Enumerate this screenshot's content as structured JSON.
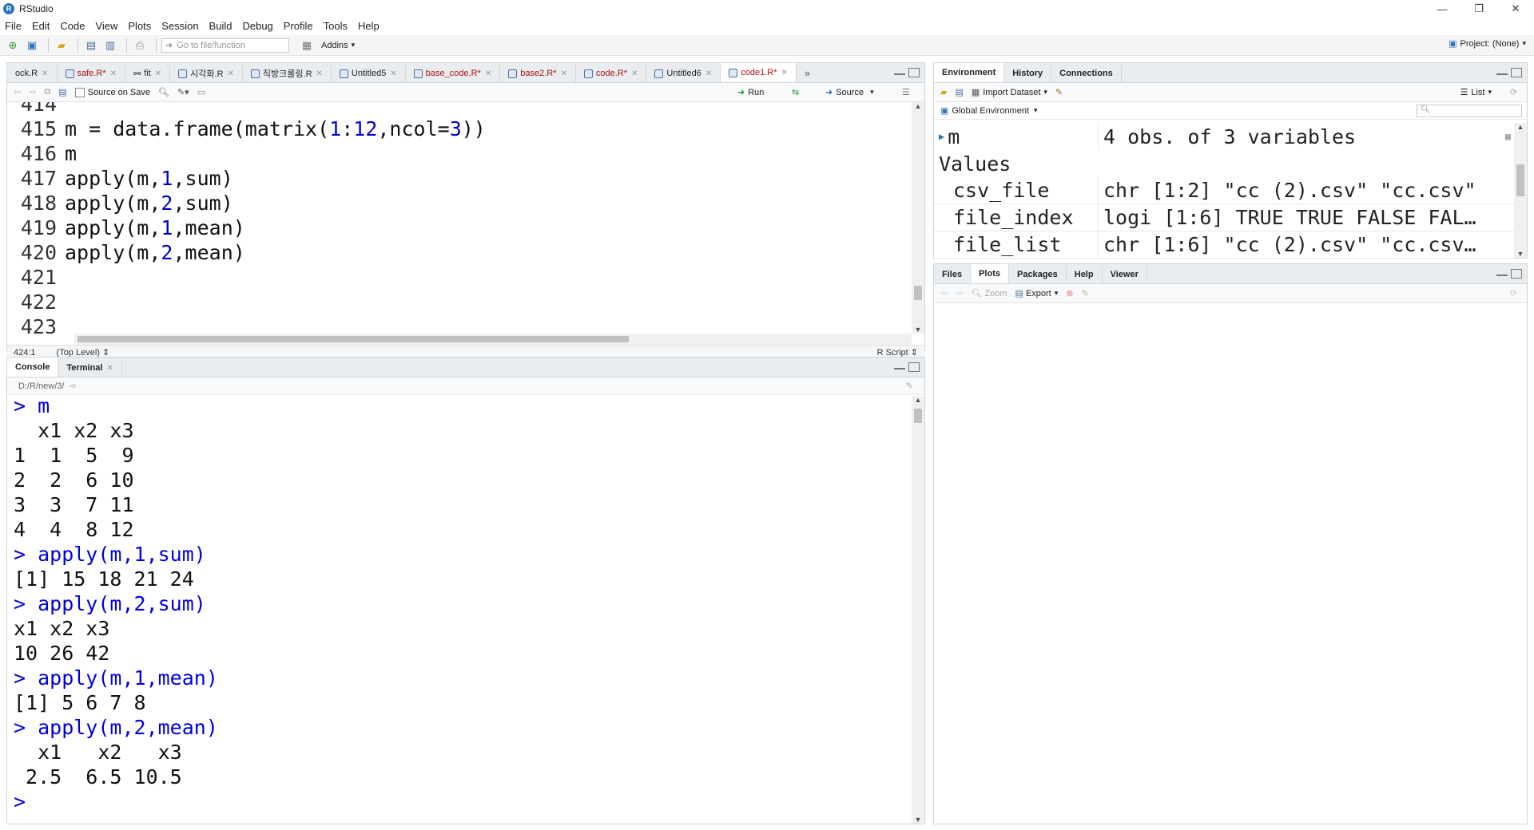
{
  "window": {
    "title": "RStudio",
    "controls": [
      "—",
      "❐",
      "✕"
    ]
  },
  "menu": [
    "File",
    "Edit",
    "Code",
    "View",
    "Plots",
    "Session",
    "Build",
    "Debug",
    "Profile",
    "Tools",
    "Help"
  ],
  "toolbar": {
    "goto_placeholder": "Go to file/function",
    "addins": "Addins",
    "project": "Project: (None)"
  },
  "editor": {
    "tabs": [
      {
        "label": "ock.R",
        "modified": false
      },
      {
        "label": "safe.R*",
        "modified": true
      },
      {
        "label": "fit",
        "modified": false
      },
      {
        "label": "시각화.R",
        "modified": false
      },
      {
        "label": "직방크롤링.R",
        "modified": false
      },
      {
        "label": "Untitled5",
        "modified": false
      },
      {
        "label": "base_code.R*",
        "modified": true
      },
      {
        "label": "base2.R*",
        "modified": true
      },
      {
        "label": "code.R*",
        "modified": true
      },
      {
        "label": "Untitled6",
        "modified": false
      },
      {
        "label": "code1.R*",
        "modified": true,
        "active": true
      }
    ],
    "source_on_save": "Source on Save",
    "run": "Run",
    "source": "Source",
    "lines": [
      {
        "n": "414",
        "code": ""
      },
      {
        "n": "415",
        "code": "m = data.frame(matrix(1:12,ncol=3))"
      },
      {
        "n": "416",
        "code": "m"
      },
      {
        "n": "417",
        "code": "apply(m,1,sum)"
      },
      {
        "n": "418",
        "code": "apply(m,2,sum)"
      },
      {
        "n": "419",
        "code": "apply(m,1,mean)"
      },
      {
        "n": "420",
        "code": "apply(m,2,mean)"
      },
      {
        "n": "421",
        "code": ""
      },
      {
        "n": "422",
        "code": ""
      },
      {
        "n": "423",
        "code": ""
      }
    ],
    "status": {
      "position": "424:1",
      "scope": "(Top Level) ⇕",
      "filetype": "R Script ⇕"
    }
  },
  "console": {
    "tabs": [
      "Console",
      "Terminal"
    ],
    "path": "D:/R/new/3/",
    "lines": [
      {
        "t": "> m",
        "cmd": true
      },
      {
        "t": "  x1 x2 x3",
        "cmd": false
      },
      {
        "t": "1  1  5  9",
        "cmd": false
      },
      {
        "t": "2  2  6 10",
        "cmd": false
      },
      {
        "t": "3  3  7 11",
        "cmd": false
      },
      {
        "t": "4  4  8 12",
        "cmd": false
      },
      {
        "t": "> apply(m,1,sum)",
        "cmd": true
      },
      {
        "t": "[1] 15 18 21 24",
        "cmd": false
      },
      {
        "t": "> apply(m,2,sum)",
        "cmd": true
      },
      {
        "t": "x1 x2 x3",
        "cmd": false
      },
      {
        "t": "10 26 42",
        "cmd": false
      },
      {
        "t": "> apply(m,1,mean)",
        "cmd": true
      },
      {
        "t": "[1] 5 6 7 8",
        "cmd": false
      },
      {
        "t": "> apply(m,2,mean)",
        "cmd": true
      },
      {
        "t": "  x1   x2   x3",
        "cmd": false
      },
      {
        "t": " 2.5  6.5 10.5",
        "cmd": false
      },
      {
        "t": ">",
        "cmd": true
      }
    ]
  },
  "environment": {
    "tabs": [
      "Environment",
      "History",
      "Connections"
    ],
    "import_dataset": "Import Dataset",
    "view_mode": "List",
    "scope": "Global Environment",
    "data_row": {
      "name": "m",
      "value": "4 obs. of 3 variables"
    },
    "values_header": "Values",
    "values": [
      {
        "name": "csv_file",
        "value": "chr [1:2] \"cc (2).csv\" \"cc.csv\""
      },
      {
        "name": "file_index",
        "value": "logi [1:6] TRUE TRUE FALSE FAL…"
      },
      {
        "name": "file_list",
        "value": "chr [1:6] \"cc (2).csv\" \"cc.csv…"
      }
    ]
  },
  "files": {
    "tabs": [
      "Files",
      "Plots",
      "Packages",
      "Help",
      "Viewer"
    ],
    "zoom": "Zoom",
    "export": "Export"
  }
}
